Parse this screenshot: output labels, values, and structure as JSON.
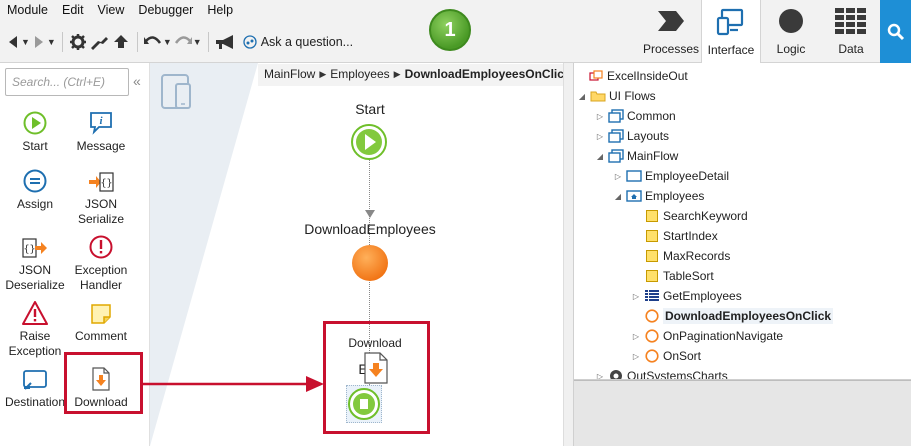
{
  "menu": [
    "Module",
    "Edit",
    "View",
    "Debugger",
    "Help"
  ],
  "toolbar": {
    "ask_label": "Ask a question..."
  },
  "step_badge": "1",
  "main_tabs": [
    {
      "label": "Processes",
      "icon": "processes-icon"
    },
    {
      "label": "Interface",
      "icon": "interface-icon",
      "active": true
    },
    {
      "label": "Logic",
      "icon": "logic-icon"
    },
    {
      "label": "Data",
      "icon": "data-icon"
    }
  ],
  "toolbox": {
    "search_placeholder": "Search... (Ctrl+E)",
    "tools": [
      "Start",
      "Message",
      "Assign",
      "JSON Serialize",
      "JSON Deserialize",
      "Exception Handler",
      "Raise Exception",
      "Comment",
      "Destination",
      "Download"
    ]
  },
  "canvas": {
    "breadcrumb": [
      "MainFlow",
      "Employees",
      "DownloadEmployeesOnClick"
    ],
    "nodes": {
      "start": "Start",
      "server_action": "DownloadEmployees",
      "download": "Download",
      "end_partial": "E"
    }
  },
  "tree": {
    "root": "ExcelInsideOut",
    "items": [
      "UI Flows",
      "Common",
      "Layouts",
      "MainFlow",
      "EmployeeDetail",
      "Employees",
      "SearchKeyword",
      "StartIndex",
      "MaxRecords",
      "TableSort",
      "GetEmployees",
      "DownloadEmployeesOnClick",
      "OnPaginationNavigate",
      "OnSort",
      "OutSystemsCharts"
    ]
  },
  "colors": {
    "accent_blue": "#1e8fd6",
    "highlight_red": "#c8102e",
    "start_green": "#6fbf2a",
    "action_orange": "#f58220"
  }
}
